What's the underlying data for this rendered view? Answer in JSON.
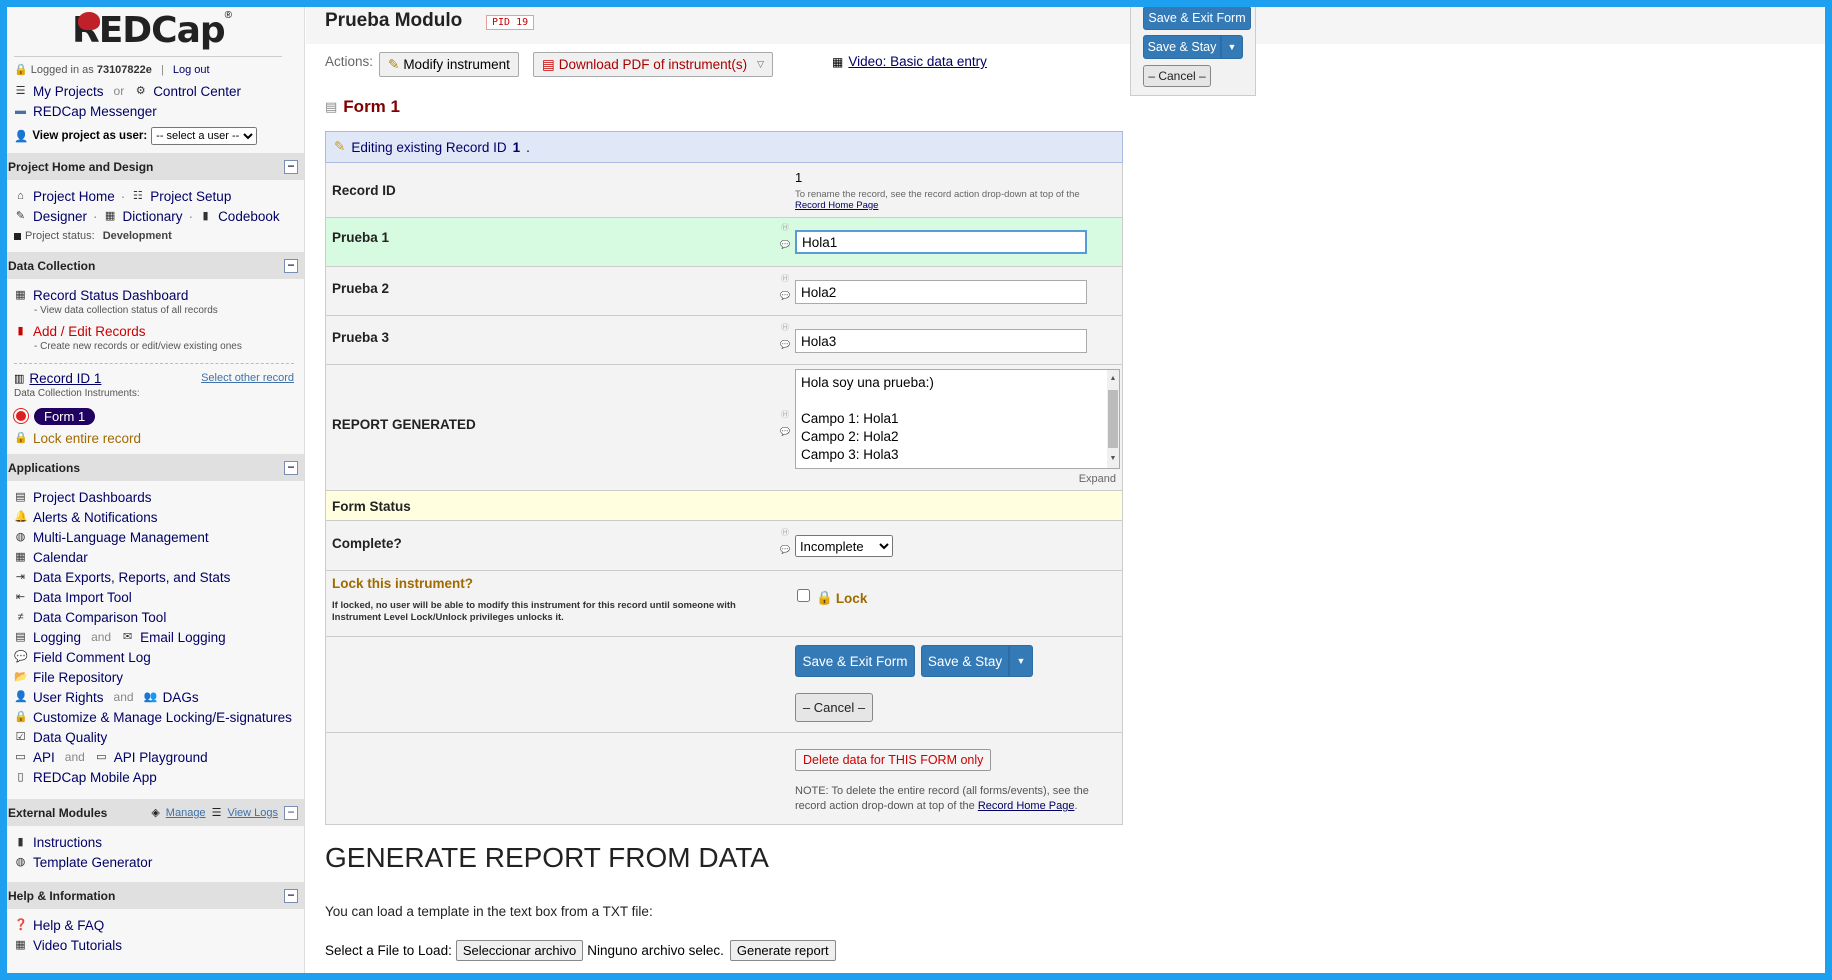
{
  "app": {
    "logo": "REDCap"
  },
  "login": {
    "prefix": "Logged in as",
    "user": "73107822e",
    "logout": "Log out"
  },
  "sidebar": {
    "top_links": {
      "my_projects": "My Projects",
      "or": "or",
      "control_center": "Control Center",
      "messenger": "REDCap Messenger"
    },
    "view_as": {
      "label": "View project as user:",
      "selected": "-- select a user --"
    },
    "sections": {
      "home": {
        "title": "Project Home and Design",
        "project_home": "Project Home",
        "project_setup": "Project Setup",
        "designer": "Designer",
        "dictionary": "Dictionary",
        "codebook": "Codebook",
        "status_label": "Project status:",
        "status_value": "Development"
      },
      "data_collection": {
        "title": "Data Collection",
        "dashboard": "Record Status Dashboard",
        "dashboard_desc": "- View data collection status of all records",
        "add_edit": "Add / Edit Records",
        "add_edit_desc": "- Create new records or edit/view existing ones",
        "record_id": "Record ID 1",
        "select_other": "Select other record",
        "instruments_label": "Data Collection Instruments:",
        "form1": "Form 1",
        "lock_record": "Lock entire record"
      },
      "applications": {
        "title": "Applications",
        "items": [
          "Project Dashboards",
          "Alerts & Notifications",
          "Multi-Language Management",
          "Calendar",
          "Data Exports, Reports, and Stats",
          "Data Import Tool",
          "Data Comparison Tool",
          "Field Comment Log",
          "File Repository",
          "Customize & Manage Locking/E-signatures",
          "Data Quality",
          "REDCap Mobile App"
        ],
        "logging": "Logging",
        "and": "and",
        "email_logging": "Email Logging",
        "user_rights": "User Rights",
        "dags": "DAGs",
        "api": "API",
        "api_playground": "API Playground"
      },
      "external": {
        "title": "External Modules",
        "manage": "Manage",
        "view_logs": "View Logs",
        "items": [
          "Instructions",
          "Template Generator"
        ]
      },
      "help": {
        "title": "Help & Information",
        "items": [
          "Help & FAQ",
          "Video Tutorials"
        ]
      }
    }
  },
  "header": {
    "title": "Prueba Modulo",
    "pid": "PID 19"
  },
  "actions": {
    "label": "Actions:",
    "modify": "Modify instrument",
    "download_pdf": "Download PDF of instrument(s)",
    "video": "Video: Basic data entry"
  },
  "float_buttons": {
    "save_exit": "Save & Exit Form",
    "save_stay": "Save & Stay",
    "cancel": "– Cancel –"
  },
  "form": {
    "title": "Form 1",
    "editing": "Editing existing Record ID",
    "editing_id": "1",
    "record_id_label": "Record ID",
    "record_id_value": "1",
    "rename_note": "To rename the record, see the record action drop-down at top of the",
    "record_home_link": "Record Home Page",
    "fields": [
      {
        "label": "Prueba 1",
        "value": "Hola1"
      },
      {
        "label": "Prueba 2",
        "value": "Hola2"
      },
      {
        "label": "Prueba 3",
        "value": "Hola3"
      }
    ],
    "report_label": "REPORT GENERATED",
    "report_lines": [
      "Hola soy una prueba:)",
      "",
      "Campo 1: Hola1",
      "Campo 2: Hola2",
      "Campo 3: Hola3"
    ],
    "expand": "Expand",
    "form_status": "Form Status",
    "complete_label": "Complete?",
    "complete_value": "Incomplete",
    "lock_title": "Lock this instrument?",
    "lock_desc": "If locked, no user will be able to modify this instrument for this record until someone with Instrument Level Lock/Unlock privileges unlocks it.",
    "lock_label": "Lock",
    "save_exit": "Save & Exit Form",
    "save_stay": "Save & Stay",
    "cancel": "– Cancel –",
    "delete": "Delete data for THIS FORM only",
    "note": "NOTE: To delete the entire record (all forms/events), see the record action drop-down at top of the",
    "note_link": "Record Home Page"
  },
  "generate": {
    "heading": "GENERATE REPORT FROM DATA",
    "intro": "You can load a template in the text box from a TXT file:",
    "select_label": "Select a File to Load:",
    "choose": "Seleccionar archivo",
    "no_file": "Ninguno archivo selec.",
    "generate": "Generate report"
  },
  "colors": {
    "accent": "#337ab7",
    "title_red": "#800000",
    "link": "#000066",
    "frame": "#1ea0f0"
  }
}
